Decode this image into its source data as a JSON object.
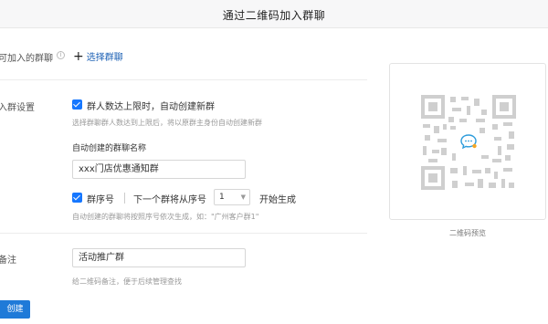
{
  "header": {
    "title": "通过二维码加入群聊"
  },
  "joinable": {
    "label": "可加入的群聊",
    "add_button": "选择群聊"
  },
  "group_settings": {
    "label": "入群设置",
    "auto_create_label": "群人数达上限时，自动创建新群",
    "auto_create_hint": "选择群聊群人数达到上限后，将以原群主身份自动创建新群",
    "name_label": "自动创建的群聊名称",
    "name_value": "xxx门店优惠通知群",
    "seq_label": "群序号",
    "next_label": "下一个群将从序号",
    "seq_value": "1",
    "start_label": "开始生成",
    "seq_hint": "自动创建的群聊将按照序号依次生成，如：\"广州客户群1\""
  },
  "remark": {
    "label": "备注",
    "value": "活动推广群",
    "hint": "给二维码备注，便于后续管理查找"
  },
  "create_button": "创建",
  "qr": {
    "caption": "二维码预览"
  },
  "colors": {
    "accent": "#1677ff",
    "button": "#1f7ad8"
  },
  "icons": [
    "info-icon",
    "plus-icon",
    "check-icon",
    "chevron-down-icon",
    "qr-code",
    "chat-bubble-icon"
  ]
}
